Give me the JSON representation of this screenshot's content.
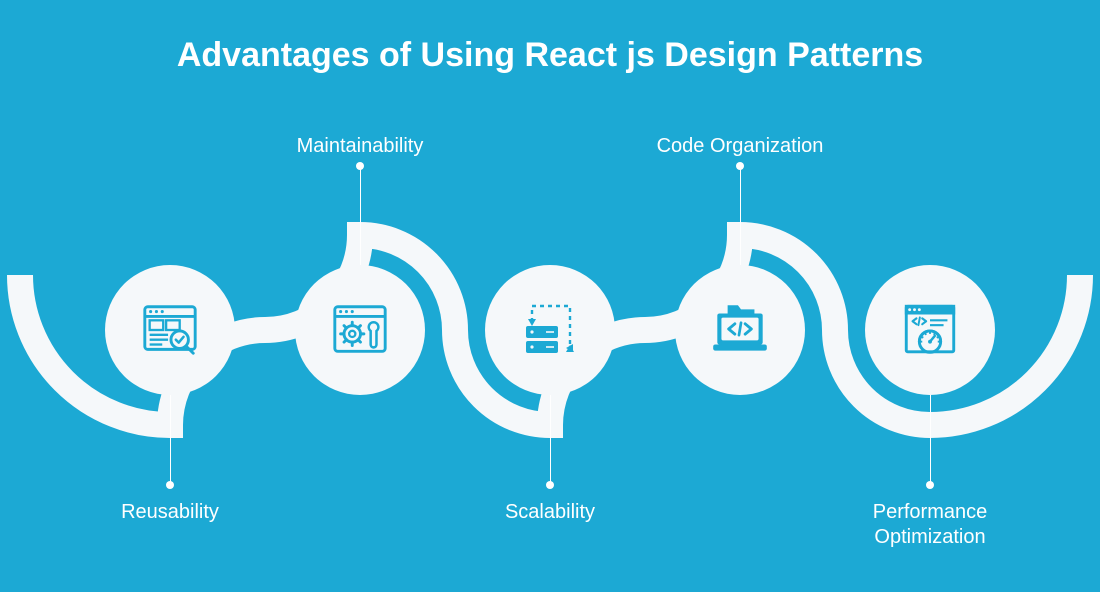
{
  "title": "Advantages of Using React js Design Patterns",
  "colors": {
    "bg": "#1ca9d4",
    "light": "#f5f8fa",
    "icon": "#1ca9d4",
    "text": "#ffffff"
  },
  "nodes": [
    {
      "label": "Reusability",
      "icon": "browser-inspect-icon",
      "labelPos": "bottom"
    },
    {
      "label": "Maintainability",
      "icon": "gear-wrench-window-icon",
      "labelPos": "top"
    },
    {
      "label": "Scalability",
      "icon": "servers-expand-icon",
      "labelPos": "bottom"
    },
    {
      "label": "Code Organization",
      "icon": "code-folder-laptop-icon",
      "labelPos": "top"
    },
    {
      "label": "Performance\nOptimization",
      "icon": "gauge-window-icon",
      "labelPos": "bottom"
    }
  ],
  "layout": {
    "spacing": 190,
    "firstX": 170,
    "centerY": 330,
    "nodeRadius": 65,
    "waveTop": 220,
    "labelTopY": 134,
    "labelBottomY": 500,
    "connTopEnd": 166,
    "connBottomEnd": 485
  }
}
